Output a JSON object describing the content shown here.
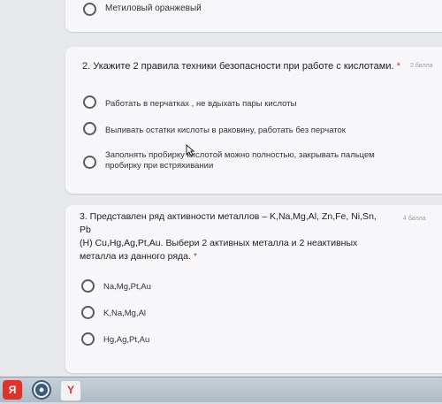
{
  "card0": {
    "option": "Метиловый оранжевый"
  },
  "q2": {
    "title": "2. Укажите 2 правила техники безопасности при работе с кислотами.",
    "required_mark": "*",
    "points": "2 балла",
    "options": [
      "Работать в перчатках , не вдыхать пары кислоты",
      "Выливать остатки кислоты в раковину, работать без перчаток",
      "Заполнять пробирку кислотой можно полностью, закрывать пальцем",
      "пробирку при встряхивании"
    ]
  },
  "q3": {
    "title_line1": "3. Представлен ряд активности металлов – K,Na,Mg,Al, Zn,Fe, Ni,Sn, Pb",
    "title_line2": "(H) Cu,Hg,Ag,Pt,Au. Выбери 2 активных металла и 2 неактивных",
    "title_line3": "металла из данного ряда.",
    "required_mark": "*",
    "points": "4 балла",
    "options": [
      "Na,Mg,Pt,Au",
      "K,Na,Mg,Al",
      "Hg,Ag,Pt,Au"
    ]
  },
  "taskbar": {
    "yandex_label": "Я",
    "browser_label": "Y"
  },
  "colors": {
    "required": "#d93025",
    "card": "#f7f7f9",
    "page": "#e7e8ec"
  }
}
